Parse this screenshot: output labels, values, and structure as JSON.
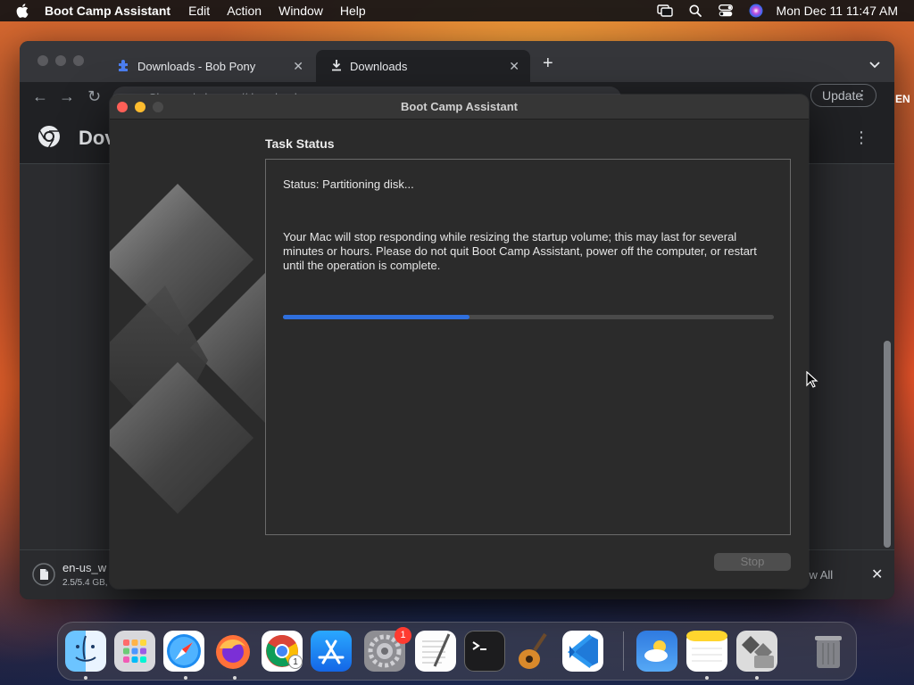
{
  "menubar": {
    "app_name": "Boot Camp Assistant",
    "menus": [
      "Edit",
      "Action",
      "Window",
      "Help"
    ],
    "clock": "Mon Dec 11  11:47 AM"
  },
  "chrome": {
    "tabs": [
      {
        "title": "Downloads - Bob Pony",
        "icon": "bob-pony-favicon"
      },
      {
        "title": "Downloads",
        "icon": "download-icon"
      }
    ],
    "omnibox_text": "Chrome  |  chrome://downloads",
    "update_label": "Update",
    "page_title": "Dov",
    "download": {
      "filename": "en-us_w",
      "progress_text": "2.5/5.4 GB,"
    },
    "show_all_label": "how All"
  },
  "bootcamp": {
    "window_title": "Boot Camp Assistant",
    "section_title": "Task Status",
    "status": "Status: Partitioning disk...",
    "warning": "Your Mac will stop responding while resizing the startup volume; this may last for several minutes or hours. Please do not quit Boot Camp Assistant, power off the computer, or restart until the operation is complete.",
    "progress_fraction": 0.38,
    "stop_label": "Stop",
    "progress_color": "#2f6fdd"
  },
  "dock": {
    "apps": [
      "Finder",
      "Launchpad",
      "Safari",
      "Firefox",
      "Google Chrome",
      "App Store",
      "System Settings",
      "TextEdit",
      "Terminal",
      "GarageBand",
      "Visual Studio Code",
      "Weather",
      "Notes",
      "Boot Camp Assistant",
      "Trash"
    ],
    "settings_badge": "1",
    "chrome_badge": "1"
  },
  "edge_text": "EN"
}
